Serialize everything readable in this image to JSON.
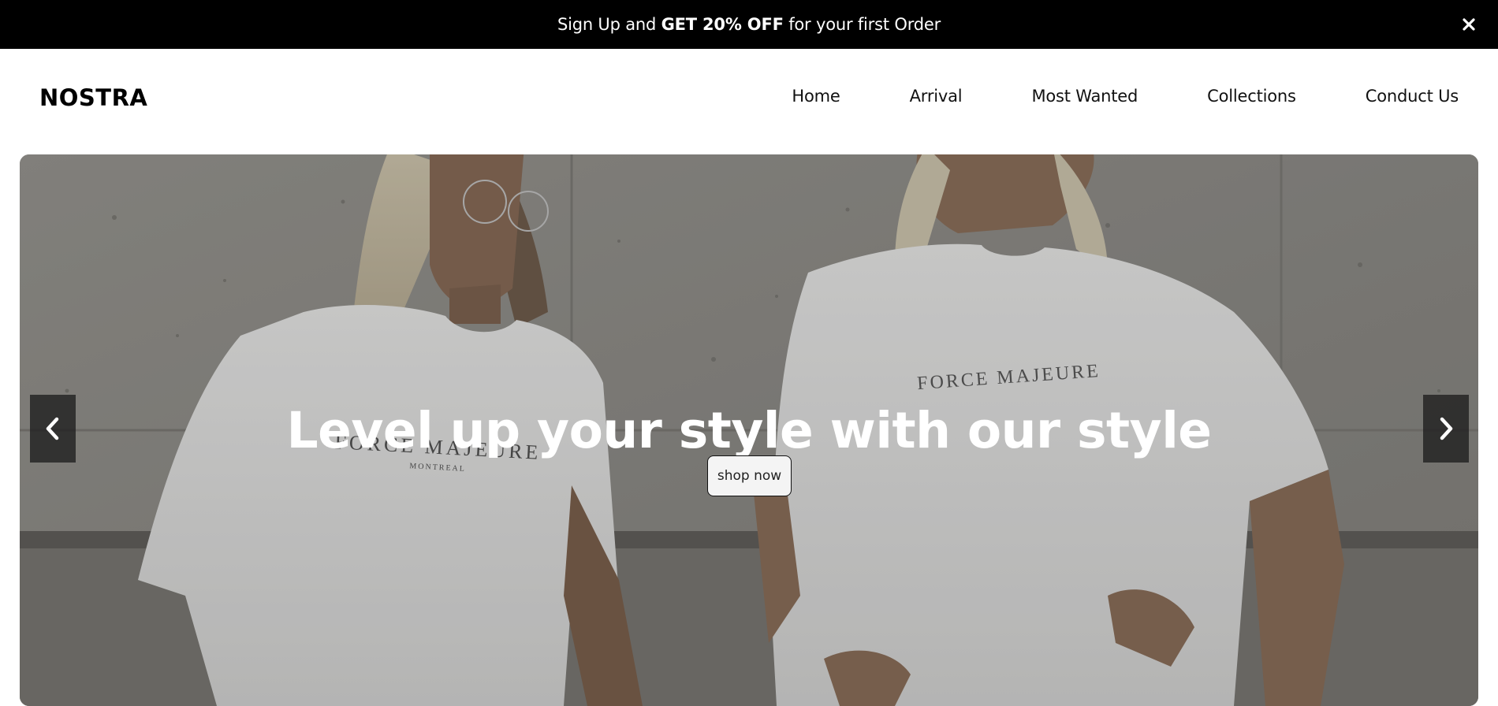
{
  "announcement": {
    "prefix": "Sign Up and ",
    "highlight": "GET 20% OFF",
    "suffix": " for your first Order",
    "close_icon": "close-icon"
  },
  "header": {
    "brand": "NOSTRA",
    "nav": [
      {
        "label": "Home"
      },
      {
        "label": "Arrival"
      },
      {
        "label": "Most Wanted"
      },
      {
        "label": "Collections"
      },
      {
        "label": "Conduct Us"
      }
    ]
  },
  "hero": {
    "title": "Level up your style with our style",
    "cta_label": "shop now",
    "prev_icon": "chevron-left-icon",
    "next_icon": "chevron-right-icon",
    "shirt_print_left": "FORCE MAJEURE",
    "shirt_print_left_sub": "MONTREAL",
    "shirt_print_right": "FORCE MAJEURE"
  },
  "colors": {
    "announce_bg": "#000000",
    "page_bg": "#ffffff",
    "text": "#111111",
    "arrow_bg": "#1e1e1e"
  }
}
